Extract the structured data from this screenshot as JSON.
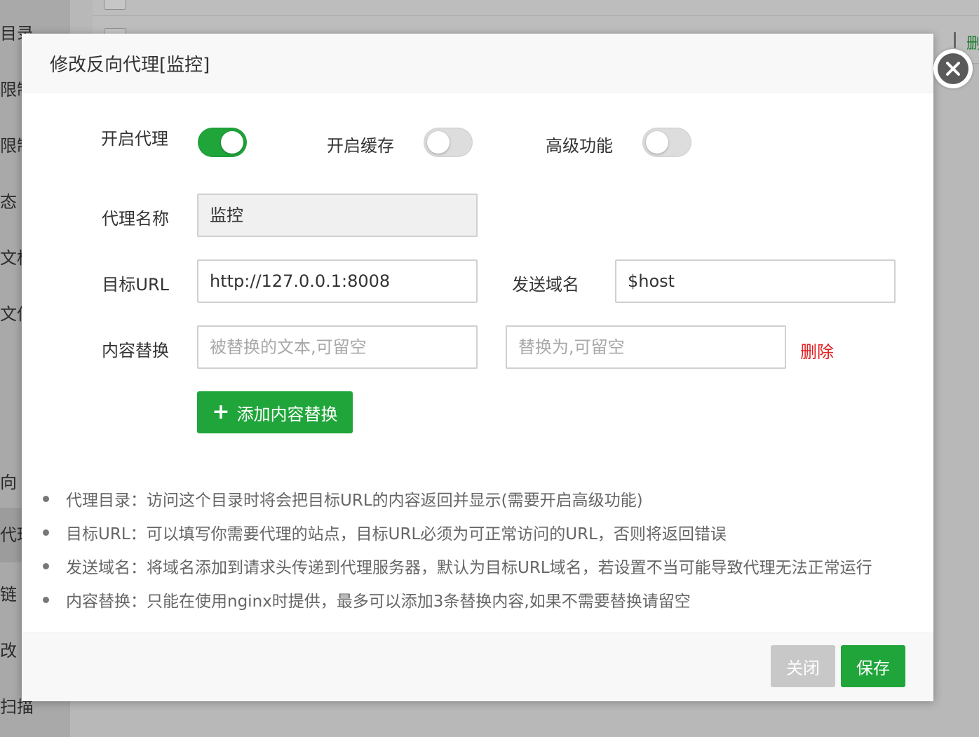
{
  "background": {
    "sidebar_fragments": [
      "目录",
      "限制",
      "限制",
      "态",
      "文档",
      "文件",
      "向",
      "代理",
      "链",
      "改",
      "扫描"
    ],
    "right_fragments": [
      "|",
      "删"
    ]
  },
  "modal": {
    "title": "修改反向代理[监控]",
    "switches": {
      "proxy": {
        "label": "开启代理",
        "on": true
      },
      "cache": {
        "label": "开启缓存",
        "on": false
      },
      "advanced": {
        "label": "高级功能",
        "on": false
      }
    },
    "proxy_name": {
      "label": "代理名称",
      "value": "监控"
    },
    "target_url": {
      "label": "目标URL",
      "value": "http://127.0.0.1:8008"
    },
    "send_domain": {
      "label": "发送域名",
      "value": "$host"
    },
    "content_replace": {
      "label": "内容替换",
      "from_placeholder": "被替换的文本,可留空",
      "to_placeholder": "替换为,可留空",
      "delete_label": "删除"
    },
    "add_replace_label": "添加内容替换",
    "tips": [
      "代理目录：访问这个目录时将会把目标URL的内容返回并显示(需要开启高级功能)",
      "目标URL：可以填写你需要代理的站点，目标URL必须为可正常访问的URL，否则将返回错误",
      "发送域名：将域名添加到请求头传递到代理服务器，默认为目标URL域名，若设置不当可能导致代理无法正常运行",
      "内容替换：只能在使用nginx时提供，最多可以添加3条替换内容,如果不需要替换请留空"
    ],
    "footer": {
      "close_label": "关闭",
      "save_label": "保存"
    }
  }
}
